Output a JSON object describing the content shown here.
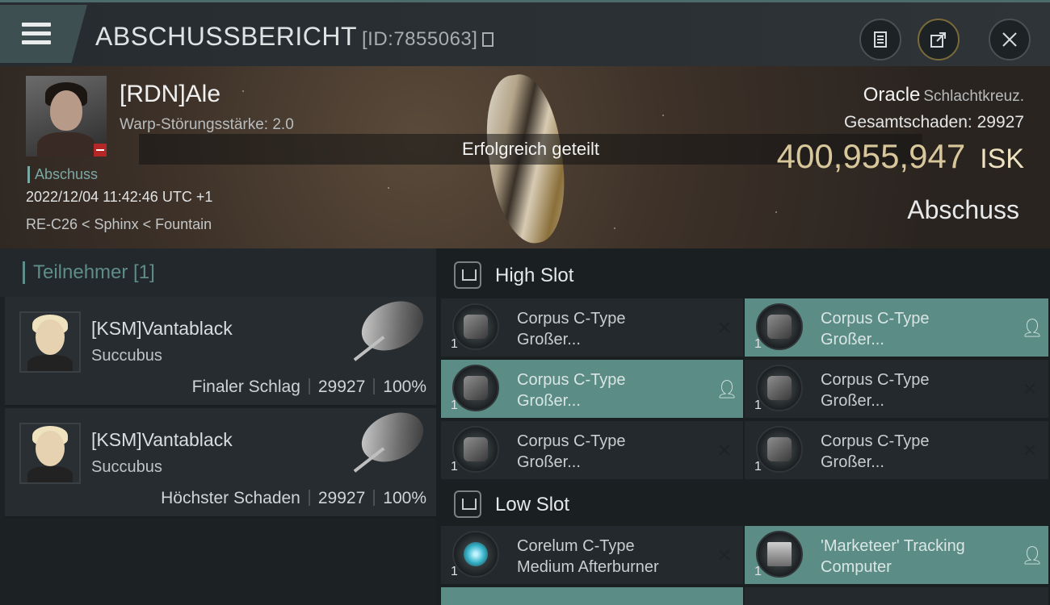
{
  "header": {
    "title": "ABSCHUSSBERICHT",
    "report_id": "[ID:7855063]"
  },
  "victim": {
    "name": "[RDN]Ale",
    "warp_disruption": "Warp-Störungsstärke: 2.0",
    "kill_tag": "Abschuss",
    "datetime": "2022/12/04 11:42:46 UTC +1",
    "location": "RE-C26 < Sphinx < Fountain",
    "ship": "Oracle",
    "ship_class": "Schlachtkreuz.",
    "total_damage_label": "Gesamtschaden:",
    "total_damage": "29927",
    "isk_value": "400,955,947",
    "isk_unit": "ISK",
    "result": "Abschuss"
  },
  "toast": "Erfolgreich geteilt",
  "participants": {
    "heading": "Teilnehmer [1]",
    "items": [
      {
        "name": "[KSM]Vantablack",
        "ship": "Succubus",
        "role": "Finaler Schlag",
        "damage": "29927",
        "percent": "100%"
      },
      {
        "name": "[KSM]Vantablack",
        "ship": "Succubus",
        "role": "Höchster Schaden",
        "damage": "29927",
        "percent": "100%"
      }
    ]
  },
  "slots": {
    "high": {
      "label": "High Slot",
      "modules": [
        {
          "qty": "1",
          "line1": "Corpus C-Type",
          "line2": "Großer...",
          "status": "destroyed"
        },
        {
          "qty": "1",
          "line1": "Corpus C-Type",
          "line2": "Großer...",
          "status": "dropped"
        },
        {
          "qty": "1",
          "line1": "Corpus C-Type",
          "line2": "Großer...",
          "status": "dropped"
        },
        {
          "qty": "1",
          "line1": "Corpus C-Type",
          "line2": "Großer...",
          "status": "destroyed"
        },
        {
          "qty": "1",
          "line1": "Corpus C-Type",
          "line2": "Großer...",
          "status": "destroyed"
        },
        {
          "qty": "1",
          "line1": "Corpus C-Type",
          "line2": "Großer...",
          "status": "destroyed"
        }
      ]
    },
    "low": {
      "label": "Low Slot",
      "modules": [
        {
          "qty": "1",
          "line1": "Corelum C-Type",
          "line2": "Medium Afterburner",
          "status": "destroyed"
        },
        {
          "qty": "1",
          "line1": "'Marketeer' Tracking",
          "line2": "Computer",
          "status": "dropped"
        }
      ]
    }
  },
  "colors": {
    "accent": "#5b8c86",
    "isk": "#d8c79a",
    "teal_text": "#5e8d8a",
    "badge_red": "#b52626"
  },
  "icons": {
    "menu": "hamburger-icon",
    "clipboard": "clipboard-icon",
    "share": "share-icon",
    "close": "close-icon",
    "copy": "copy-icon",
    "destroyed": "x-icon",
    "dropped": "person-icon"
  }
}
